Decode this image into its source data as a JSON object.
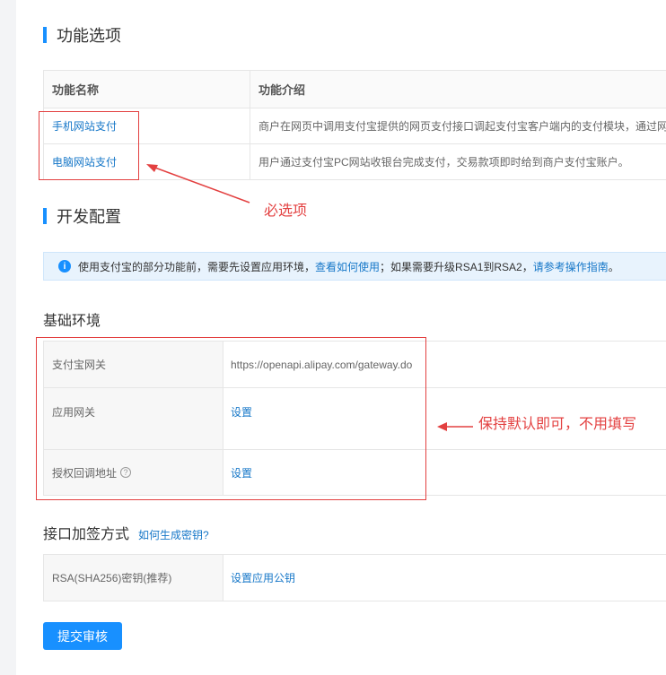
{
  "func_section": {
    "title": "功能选项",
    "table": {
      "col_name": "功能名称",
      "col_desc": "功能介绍",
      "rows": [
        {
          "name": "手机网站支付",
          "desc": "商户在网页中调用支付宝提供的网页支付接口调起支付宝客户端内的支付模块，通过网"
        },
        {
          "name": "电脑网站支付",
          "desc": "用户通过支付宝PC网站收银台完成支付，交易款项即时给到商户支付宝账户。"
        }
      ]
    },
    "annotation": "必选项"
  },
  "dev_section": {
    "title": "开发配置",
    "info": {
      "text_before": "使用支付宝的部分功能前，需要先设置应用环境，",
      "link1": "查看如何使用",
      "text_middle": "；如果需要升级RSA1到RSA2，",
      "link2": "请参考操作指南",
      "text_end": "。"
    }
  },
  "basic_env": {
    "title": "基础环境",
    "gateway_label": "支付宝网关",
    "gateway_value": "https://openapi.alipay.com/gateway.do",
    "app_gateway_label": "应用网关",
    "app_gateway_action": "设置",
    "callback_label": "授权回调地址",
    "callback_action": "设置",
    "annotation": "保持默认即可，不用填写"
  },
  "sign_section": {
    "title": "接口加签方式",
    "help_link": "如何生成密钥?",
    "key_label": "RSA(SHA256)密钥(推荐)",
    "key_action": "设置应用公钥"
  },
  "submit_label": "提交审核",
  "colors": {
    "accent": "#1890ff",
    "link": "#1677c8",
    "annotation": "#e34040"
  },
  "icons": {
    "info": "info-circle-icon",
    "help": "question-circle-icon",
    "arrow": "red-arrow-icon"
  }
}
